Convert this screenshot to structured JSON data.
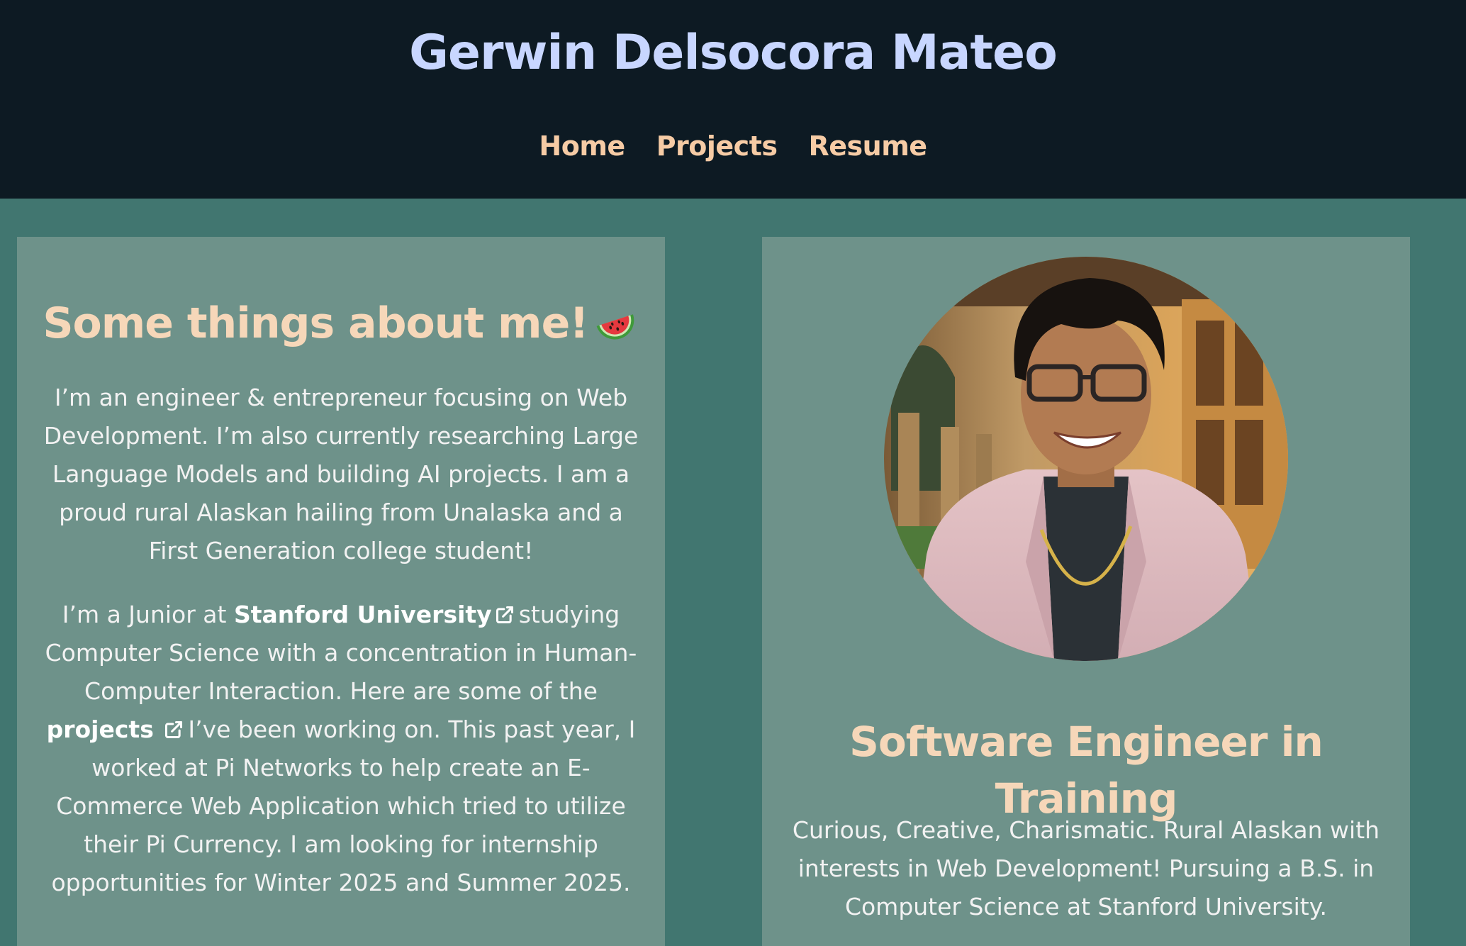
{
  "header": {
    "site_title": "Gerwin Delsocora Mateo",
    "nav": [
      "Home",
      "Projects",
      "Resume"
    ]
  },
  "about": {
    "title": "Some things about me!",
    "emoji_icon": "watermelon-icon",
    "paragraph1": "I’m an engineer & entrepreneur focusing on Web Development. I’m also currently researching Large Language Models and building AI projects. I am a proud rural Alaskan hailing from Unalaska and a First Generation college student!",
    "p2_prefix": "I’m a Junior at",
    "p2_link_stanford": "Stanford University",
    "p2_middle": "studying Computer Science with a concentration in Human-Computer Interaction. Here are some of the",
    "p2_link_projects": "projects",
    "p2_suffix": "I’ve been working on. This past year, I worked at Pi Networks to help create an E-Commerce Web Application which tried to utilize their Pi Currency. I am looking for internship opportunities for Winter 2025 and Summer 2025."
  },
  "profile": {
    "photo_alt": "Portrait of Gerwin Delsocora Mateo",
    "title": "Software Engineer in Training",
    "tagline": "Curious, Creative, Charismatic. Rural Alaskan with interests in Web Development! Pursuing a B.S. in Computer Science at Stanford University."
  },
  "colors": {
    "header_bg": "#0d1a23",
    "page_bg": "#417670",
    "card_bg": "#6e928a",
    "title_color": "#c8d6ff",
    "accent_peach": "#f6cba5"
  }
}
